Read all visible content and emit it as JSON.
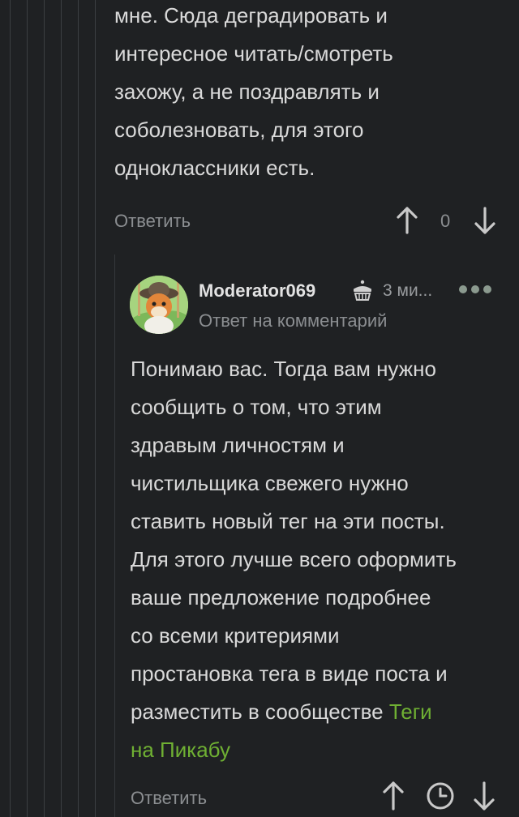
{
  "comment1": {
    "lines": [
      "мне. Сюда деградировать и",
      "интересное читать/смотреть",
      "захожу, а не поздравлять и",
      "соболезновать, для этого",
      "одноклассники есть."
    ],
    "reply_label": "Ответить",
    "vote_count": "0"
  },
  "comment2": {
    "author": "Moderator069",
    "time": "3 ми...",
    "subtitle": "Ответ на комментарий",
    "lines": [
      "Понимаю вас. Тогда вам нужно",
      "сообщить о том, что этим",
      "здравым личностям и",
      "чистильщика свежего нужно",
      "ставить новый тег на эти посты.",
      "Для этого лучше всего оформить",
      "ваше предложение подробнее",
      "со всеми критериями",
      "простановка тега в виде поста и"
    ],
    "line_before_link": "разместить в сообществе ",
    "link_part1": "Теги",
    "link_part2": "на Пикабу",
    "reply_label": "Ответить"
  },
  "colors": {
    "background": "#1f2123",
    "text": "#d9d9d9",
    "muted": "#8b8e91",
    "link": "#6fb033"
  },
  "icons": [
    "arrow-up-icon",
    "arrow-down-icon",
    "cake-icon",
    "more-dots-icon",
    "clock-icon"
  ]
}
